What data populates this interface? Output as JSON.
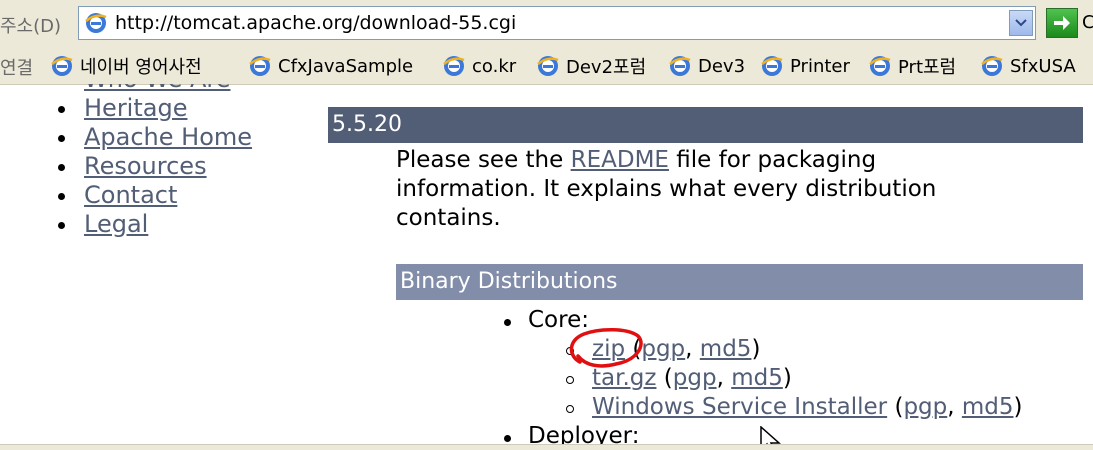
{
  "address_bar": {
    "label": "주소(D)",
    "url": "http://tomcat.apache.org/download-55.cgi",
    "go_fragment": "C"
  },
  "links_bar": {
    "label": "연결",
    "items": [
      {
        "label": "네이버 영어사전"
      },
      {
        "label": "CfxJavaSample"
      },
      {
        "label": "co.kr"
      },
      {
        "label": "Dev2포럼"
      },
      {
        "label": "Dev3"
      },
      {
        "label": "Printer"
      },
      {
        "label": "Prt포럼"
      },
      {
        "label": "SfxUSA"
      }
    ]
  },
  "sidebar": {
    "items": [
      {
        "label": "Who We Are"
      },
      {
        "label": "Heritage"
      },
      {
        "label": "Apache Home"
      },
      {
        "label": "Resources"
      },
      {
        "label": "Contact"
      },
      {
        "label": "Legal"
      }
    ]
  },
  "main": {
    "version_heading": "5.5.20",
    "intro": {
      "before": "Please see the ",
      "link": "README",
      "after": " file for packaging information. It explains what every distribution contains."
    },
    "section_heading": "Binary Distributions",
    "core": {
      "label": "Core:",
      "items": [
        {
          "name": "zip",
          "pgp": "pgp",
          "md5": "md5"
        },
        {
          "name": "tar.gz",
          "pgp": "pgp",
          "md5": "md5"
        },
        {
          "name": "Windows Service Installer",
          "pgp": "pgp",
          "md5": "md5"
        }
      ]
    },
    "deployer": {
      "label": "Deployer:"
    }
  },
  "colors": {
    "version_bar": "#525d76",
    "section_bar": "#828daa",
    "link": "#525d76",
    "annotation": "#e01010"
  }
}
